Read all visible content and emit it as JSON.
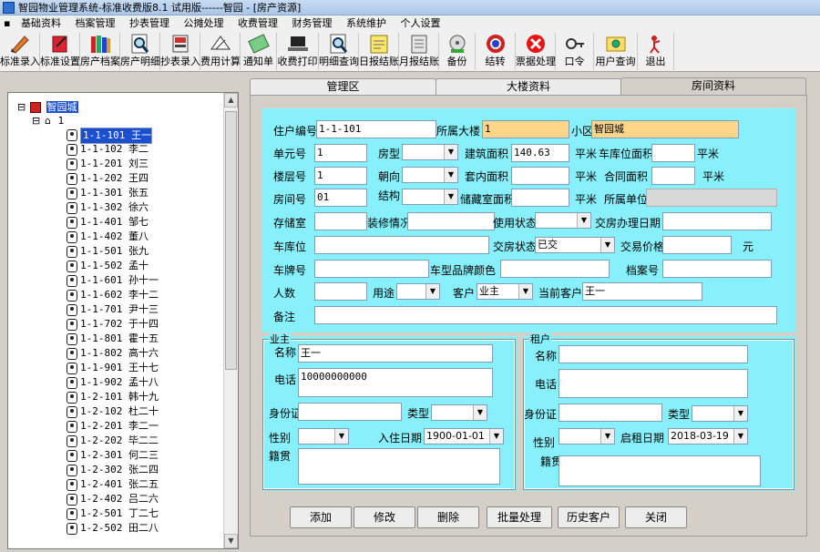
{
  "window": {
    "title": "智园物业管理系统-标准收费版8.1 试用版------智园 - [房产资源]"
  },
  "menu": [
    "基础资料",
    "档案管理",
    "抄表管理",
    "公摊处理",
    "收费管理",
    "财务管理",
    "系统维护",
    "个人设置"
  ],
  "toolbar": [
    {
      "label": "标准录入",
      "icon": "edit-icon"
    },
    {
      "label": "标准设置",
      "icon": "settings-icon"
    },
    {
      "label": "房产档案",
      "icon": "books-icon"
    },
    {
      "label": "房产明细",
      "icon": "magnifier-icon"
    },
    {
      "label": "抄表录入",
      "icon": "meter-icon"
    },
    {
      "label": "费用计算",
      "icon": "calculator-icon"
    },
    {
      "label": "通知单",
      "icon": "notice-icon"
    },
    {
      "label": "收费打印",
      "icon": "laptop-icon"
    },
    {
      "label": "明细查询",
      "icon": "search-doc-icon"
    },
    {
      "label": "日报结账",
      "icon": "daily-report-icon"
    },
    {
      "label": "月报结账",
      "icon": "monthly-report-icon"
    },
    {
      "label": "备份",
      "icon": "backup-disk-icon"
    },
    {
      "label": "结转",
      "icon": "carryover-icon"
    },
    {
      "label": "票据处理",
      "icon": "no-entry-icon"
    },
    {
      "label": "口令",
      "icon": "key-icon"
    },
    {
      "label": "用户查询",
      "icon": "user-search-icon"
    },
    {
      "label": "退出",
      "icon": "exit-icon"
    }
  ],
  "tree": {
    "root": "智园城",
    "building": "1",
    "nodes": [
      "1-1-101 王一",
      "1-1-102 李二",
      "1-1-201 刘三",
      "1-1-202 王四",
      "1-1-301 张五",
      "1-1-302 徐六",
      "1-1-401 邹七",
      "1-1-402 董八",
      "1-1-501 张九",
      "1-1-502 孟十",
      "1-1-601 孙十一",
      "1-1-602 李十二",
      "1-1-701 尹十三",
      "1-1-702 于十四",
      "1-1-801 霍十五",
      "1-1-802 高十六",
      "1-1-901 王十七",
      "1-1-902 孟十八",
      "1-2-101 韩十九",
      "1-2-102 杜二十",
      "1-2-201 李二一",
      "1-2-202 毕二二",
      "1-2-301 何二三",
      "1-2-302 张二四",
      "1-2-401 张二五",
      "1-2-402 吕二六",
      "1-2-501 丁二七",
      "1-2-502 田二八"
    ]
  },
  "tabs": [
    "管理区",
    "大楼资料",
    "房间资料"
  ],
  "room": {
    "labels": {
      "zhuhu_no": "住户编号",
      "building": "所属大楼",
      "xiaoqu": "小区",
      "unit_no": "单元号",
      "house_type": "房型",
      "build_area": "建筑面积",
      "sqm1": "平米",
      "garage_area": "车库位面积",
      "sqm2": "平米",
      "floor_no": "楼层号",
      "orientation": "朝向",
      "inner_area": "套内面积",
      "sqm3": "平米",
      "contract_area": "合同面积",
      "sqm4": "平米",
      "room_no": "房间号",
      "structure": "结构",
      "storage_area": "储藏室面积",
      "sqm5": "平米",
      "dept": "所属单位",
      "storage": "存储室",
      "decoration": "装修情况",
      "use_status": "使用状态",
      "handover_date": "交房办理日期",
      "garage": "车库位",
      "handover_status": "交房状态",
      "trade_price": "交易价格",
      "yuan": "元",
      "plate": "车牌号",
      "car_model": "车型品牌颜色",
      "archive_no": "档案号",
      "people": "人数",
      "usage": "用途",
      "customer": "客户",
      "current_customer": "当前客户",
      "remark": "备注"
    },
    "values": {
      "zhuhu_no": "1-1-101",
      "building": "1",
      "xiaoqu": "智园城",
      "unit_no": "1",
      "build_area": "140.63",
      "floor_no": "1",
      "room_no": "01",
      "handover_status": "已交",
      "customer": "业主",
      "current_customer": "王一"
    }
  },
  "owner": {
    "title": "业主",
    "labels": {
      "name": "名称",
      "phone": "电话",
      "id_card": "身份证",
      "type": "类型",
      "gender": "性别",
      "move_in": "入住日期",
      "native": "籍贯"
    },
    "values": {
      "name": "王一",
      "phone": "10000000000",
      "move_in": "1900-01-01"
    }
  },
  "tenant": {
    "title": "租户",
    "labels": {
      "name": "名称",
      "phone": "电话",
      "id_card": "身份证",
      "type": "类型",
      "gender": "性别",
      "lease_date": "启租日期",
      "native": "籍贯"
    },
    "values": {
      "lease_date": "2018-03-19"
    }
  },
  "buttons": [
    "添加",
    "修改",
    "删除",
    "批量处理",
    "历史客户",
    "关闭"
  ],
  "colors": {
    "form_bg": "#88f0fa",
    "readonly_bg": "#ffd58a",
    "selection": "#1c4fd0"
  }
}
